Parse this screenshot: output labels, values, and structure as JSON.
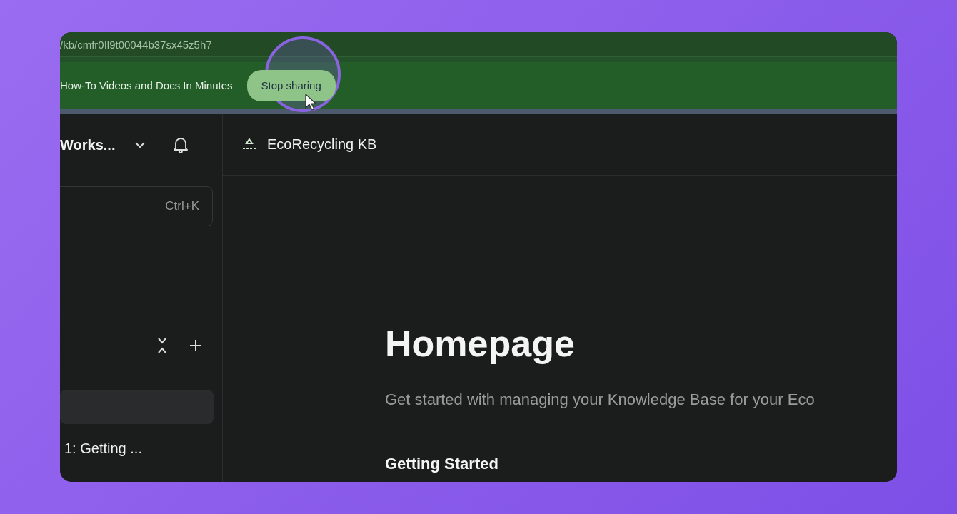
{
  "address_bar": {
    "url": "/kb/cmfr0Il9t00044b37sx45z5h7"
  },
  "share_banner": {
    "message": "How-To Videos and Docs In Minutes",
    "button": "Stop sharing"
  },
  "sidebar": {
    "workspace": "Works...",
    "search": {
      "shortcut": "Ctrl+K"
    },
    "pages": [
      {
        "selected": true
      },
      {
        "label": "1: Getting ...",
        "selected": false
      }
    ]
  },
  "header": {
    "title": "EcoRecycling KB"
  },
  "content": {
    "title": "Homepage",
    "description": "Get started with managing your Knowledge Base for your Eco",
    "section": "Getting Started"
  }
}
